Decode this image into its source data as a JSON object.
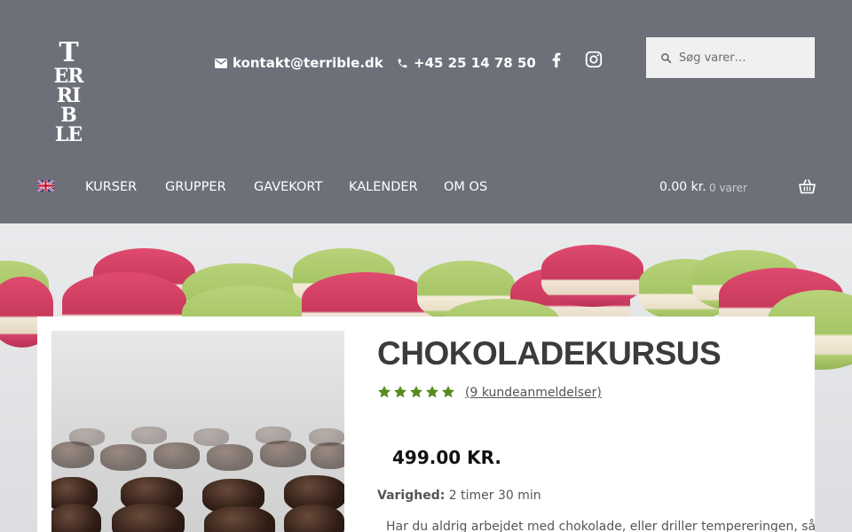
{
  "logo": {
    "lines": [
      "T",
      "ER",
      "RI",
      "B",
      "LE"
    ]
  },
  "header": {
    "email": "kontakt@terrible.dk",
    "phone": "+45 25 14 78 50",
    "social": [
      "facebook-icon",
      "instagram-icon"
    ],
    "search_placeholder": "Søg varer…"
  },
  "nav": {
    "language_flag": "uk-flag-icon",
    "items": [
      {
        "label": "KURSER"
      },
      {
        "label": "GRUPPER"
      },
      {
        "label": "GAVEKORT"
      },
      {
        "label": "KALENDER"
      },
      {
        "label": "OM OS"
      }
    ]
  },
  "cart": {
    "total": "0.00 kr.",
    "count": "0 varer",
    "icon": "basket-icon"
  },
  "product": {
    "title": "CHOKOLADEKURSUS",
    "rating": 5,
    "reviews": "(9 kundeanmeldelser)",
    "price": "499.00 KR.",
    "duration_label": "Varighed:",
    "duration_value": "2 timer 30 min",
    "description": "Har du aldrig arbejdet med chokolade, eller driller tempereringen, så"
  },
  "colors": {
    "header_bg": "#6d7079",
    "star": "#5b8a1f",
    "title": "#3b3b3b"
  }
}
